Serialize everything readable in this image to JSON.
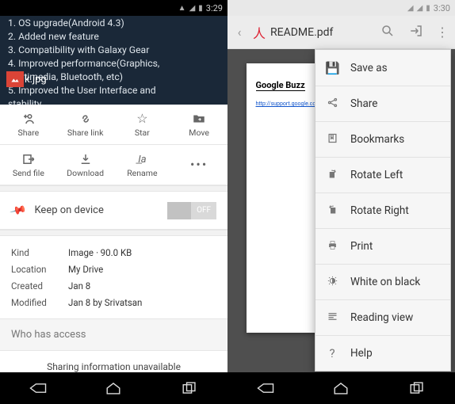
{
  "left": {
    "status": {
      "time": "3:29"
    },
    "preview_lines": [
      "1. OS upgrade(Android 4.3)",
      "2. Added new feature",
      "3. Compatibility with Galaxy Gear",
      "4. Improved performance(Graphics,",
      "Multimedia, Bluetooth, etc)",
      "5. Improved the User Interface and",
      "stability"
    ],
    "file": {
      "name": "k.jpg",
      "icon": "image"
    },
    "actions_row1": [
      {
        "label": "Share",
        "icon": "person-plus"
      },
      {
        "label": "Share link",
        "icon": "link"
      },
      {
        "label": "Star",
        "icon": "star"
      },
      {
        "label": "Move",
        "icon": "folder-move"
      }
    ],
    "actions_row2": [
      {
        "label": "Send file",
        "icon": "export"
      },
      {
        "label": "Download",
        "icon": "download"
      },
      {
        "label": "Rename",
        "icon": "rename"
      },
      {
        "label": "",
        "icon": "more"
      }
    ],
    "keep_on_device": {
      "label": "Keep on device",
      "state": "OFF"
    },
    "meta": {
      "kind_label": "Kind",
      "kind_value": "Image ᐧ 90.0 KB",
      "location_label": "Location",
      "location_value": "My Drive",
      "created_label": "Created",
      "created_value": "Jan 8",
      "modified_label": "Modified",
      "modified_value": "Jan 8 by Srivatsan"
    },
    "access": {
      "header": "Who has access",
      "body": "Sharing information unavailable"
    }
  },
  "right": {
    "status": {
      "time": "3:30"
    },
    "title": "README.pdf",
    "doc": {
      "heading": "Google Buzz",
      "link": "http://support.google.com/drive/?p=dr"
    },
    "menu": [
      {
        "label": "Save as",
        "icon": "save"
      },
      {
        "label": "Share",
        "icon": "share"
      },
      {
        "label": "Bookmarks",
        "icon": "bookmark"
      },
      {
        "label": "Rotate Left",
        "icon": "rotate-left"
      },
      {
        "label": "Rotate Right",
        "icon": "rotate-right"
      },
      {
        "label": "Print",
        "icon": "print"
      },
      {
        "label": "White on black",
        "icon": "contrast"
      },
      {
        "label": "Reading view",
        "icon": "reading"
      },
      {
        "label": "Help",
        "icon": "help"
      }
    ]
  }
}
